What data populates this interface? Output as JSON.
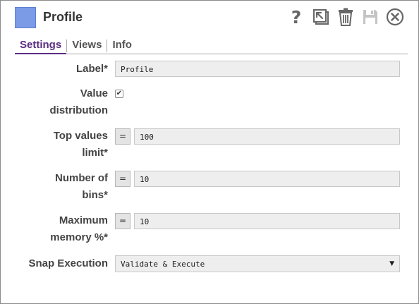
{
  "header": {
    "title": "Profile",
    "icon_color": "#7b9be6",
    "toolbar": [
      {
        "name": "help-icon",
        "glyph": "?"
      },
      {
        "name": "export-icon"
      },
      {
        "name": "delete-icon"
      },
      {
        "name": "save-icon"
      },
      {
        "name": "close-icon"
      }
    ]
  },
  "tabs": [
    {
      "label": "Settings",
      "active": true
    },
    {
      "label": "Views",
      "active": false
    },
    {
      "label": "Info",
      "active": false
    }
  ],
  "form": {
    "label_field": {
      "label": "Label*",
      "value": "Profile"
    },
    "value_distribution": {
      "label_line1": "Value",
      "label_line2": "distribution",
      "checked": true,
      "check_glyph": "✔"
    },
    "top_values_limit": {
      "label_line1": "Top values",
      "label_line2": "limit*",
      "expr_glyph": "=",
      "value": "100"
    },
    "number_of_bins": {
      "label_line1": "Number of",
      "label_line2": "bins*",
      "expr_glyph": "=",
      "value": "10"
    },
    "max_memory": {
      "label_line1": "Maximum",
      "label_line2": "memory %*",
      "expr_glyph": "=",
      "value": "10"
    },
    "snap_execution": {
      "label": "Snap Execution",
      "value": "Validate & Execute",
      "arrow_glyph": "▼"
    }
  },
  "colors": {
    "accent": "#5a2d82",
    "field_bg": "#eeeeee"
  }
}
